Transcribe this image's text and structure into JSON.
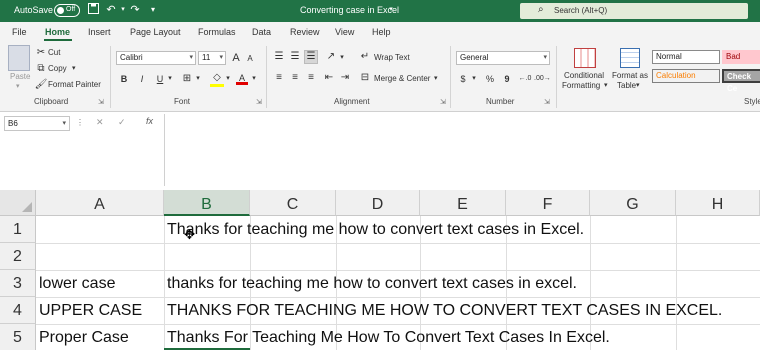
{
  "titlebar": {
    "autosave_label": "AutoSave",
    "autosave_state": "Off",
    "document_title": "Converting case in Excel",
    "search_placeholder": "Search (Alt+Q)"
  },
  "tabs": [
    "File",
    "Home",
    "Insert",
    "Page Layout",
    "Formulas",
    "Data",
    "Review",
    "View",
    "Help"
  ],
  "active_tab": "Home",
  "ribbon": {
    "clipboard": {
      "label": "Clipboard",
      "paste": "Paste",
      "cut": "Cut",
      "copy": "Copy",
      "format_painter": "Format Painter"
    },
    "font": {
      "label": "Font",
      "font_name": "Calibri",
      "font_size": "11",
      "bold": "B",
      "italic": "I",
      "underline": "U",
      "grow": "A",
      "shrink": "A",
      "font_color": "A"
    },
    "alignment": {
      "label": "Alignment",
      "wrap_text": "Wrap Text",
      "merge_center": "Merge & Center"
    },
    "number": {
      "label": "Number",
      "format": "General",
      "currency": "$",
      "percent": "%",
      "comma": "9"
    },
    "styles": {
      "label": "Style",
      "conditional_formatting_line1": "Conditional",
      "conditional_formatting_line2": "Formatting",
      "format_as_table_line1": "Format as",
      "format_as_table_line2": "Table",
      "normal": "Normal",
      "bad": "Bad",
      "calculation": "Calculation",
      "check_cell": "Check Ce"
    }
  },
  "formula_bar": {
    "name_box": "B6",
    "fx": "fx",
    "formula": ""
  },
  "grid": {
    "columns": [
      "A",
      "B",
      "C",
      "D",
      "E",
      "F",
      "G",
      "H"
    ],
    "selected_column": "B",
    "rows": [
      {
        "num": "1",
        "a": "",
        "b": "Thanks for teaching me how to convert text cases in Excel."
      },
      {
        "num": "2",
        "a": "",
        "b": ""
      },
      {
        "num": "3",
        "a": "lower case",
        "b": "thanks for teaching me how to convert text cases in excel."
      },
      {
        "num": "4",
        "a": "UPPER CASE",
        "b": "THANKS FOR TEACHING ME HOW TO CONVERT TEXT CASES IN EXCEL."
      },
      {
        "num": "5",
        "a": "Proper Case",
        "b": "Thanks For Teaching Me How To Convert Text Cases In Excel."
      }
    ]
  },
  "colors": {
    "brand": "#217346",
    "accent": "#1e6b3c"
  }
}
